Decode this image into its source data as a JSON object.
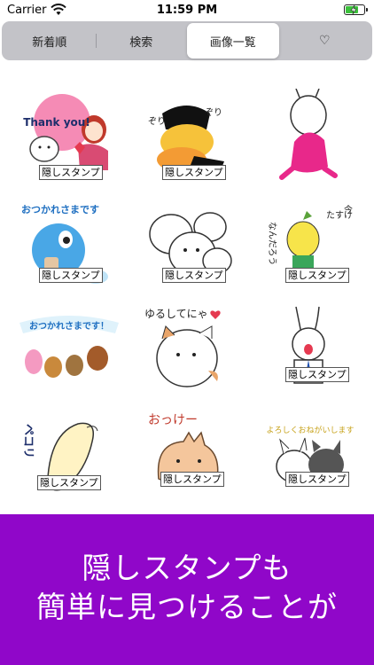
{
  "status_bar": {
    "carrier": "Carrier",
    "time": "11:59 PM",
    "wifi_icon": "wifi-icon",
    "battery_icon": "battery-charging-icon"
  },
  "segments": [
    {
      "label": "新着順",
      "active": false
    },
    {
      "label": "検索",
      "active": false
    },
    {
      "label": "画像一覧",
      "active": true
    },
    {
      "label": "♡",
      "active": false
    }
  ],
  "stickers": [
    {
      "name": "thank-you-sticker",
      "badge": "隠しスタンプ",
      "art_text": "Thank you!"
    },
    {
      "name": "zori-zori-sticker",
      "badge": "隠しスタンプ",
      "art_text": "ぞりぞり"
    },
    {
      "name": "bunny-pink-sticker",
      "badge": "",
      "art_text": ""
    },
    {
      "name": "otsukaresama-blue-sticker",
      "badge": "隠しスタンプ",
      "art_text": "おつかれさまです"
    },
    {
      "name": "seal-group-sticker",
      "badge": "隠しスタンプ",
      "art_text": ""
    },
    {
      "name": "tasukeai-sticker",
      "badge": "隠しスタンプ",
      "art_text": "今できる たすけあいって なんだろう？"
    },
    {
      "name": "otsukaresama-animals-sticker",
      "badge": "",
      "art_text": "おつかれさまです！"
    },
    {
      "name": "yurushitenya-cat-sticker",
      "badge": "",
      "art_text": "ゆるしてにゃ"
    },
    {
      "name": "bunny-suit-sticker",
      "badge": "隠しスタンプ",
      "art_text": ""
    },
    {
      "name": "pekori-sticker",
      "badge": "隠しスタンプ",
      "art_text": "ペコリ"
    },
    {
      "name": "okke-cat-sticker",
      "badge": "隠しスタンプ",
      "art_text": "おっけー"
    },
    {
      "name": "onegaishimasu-sticker",
      "badge": "隠しスタンプ",
      "art_text": "よろしくおねがいします"
    }
  ],
  "banner": {
    "line1": "隠しスタンプも",
    "line2": "簡単に見つけることが"
  },
  "colors": {
    "banner_bg": "#9007c9",
    "segment_bg": "#c3c3c8",
    "battery_green": "#3cc13c"
  }
}
